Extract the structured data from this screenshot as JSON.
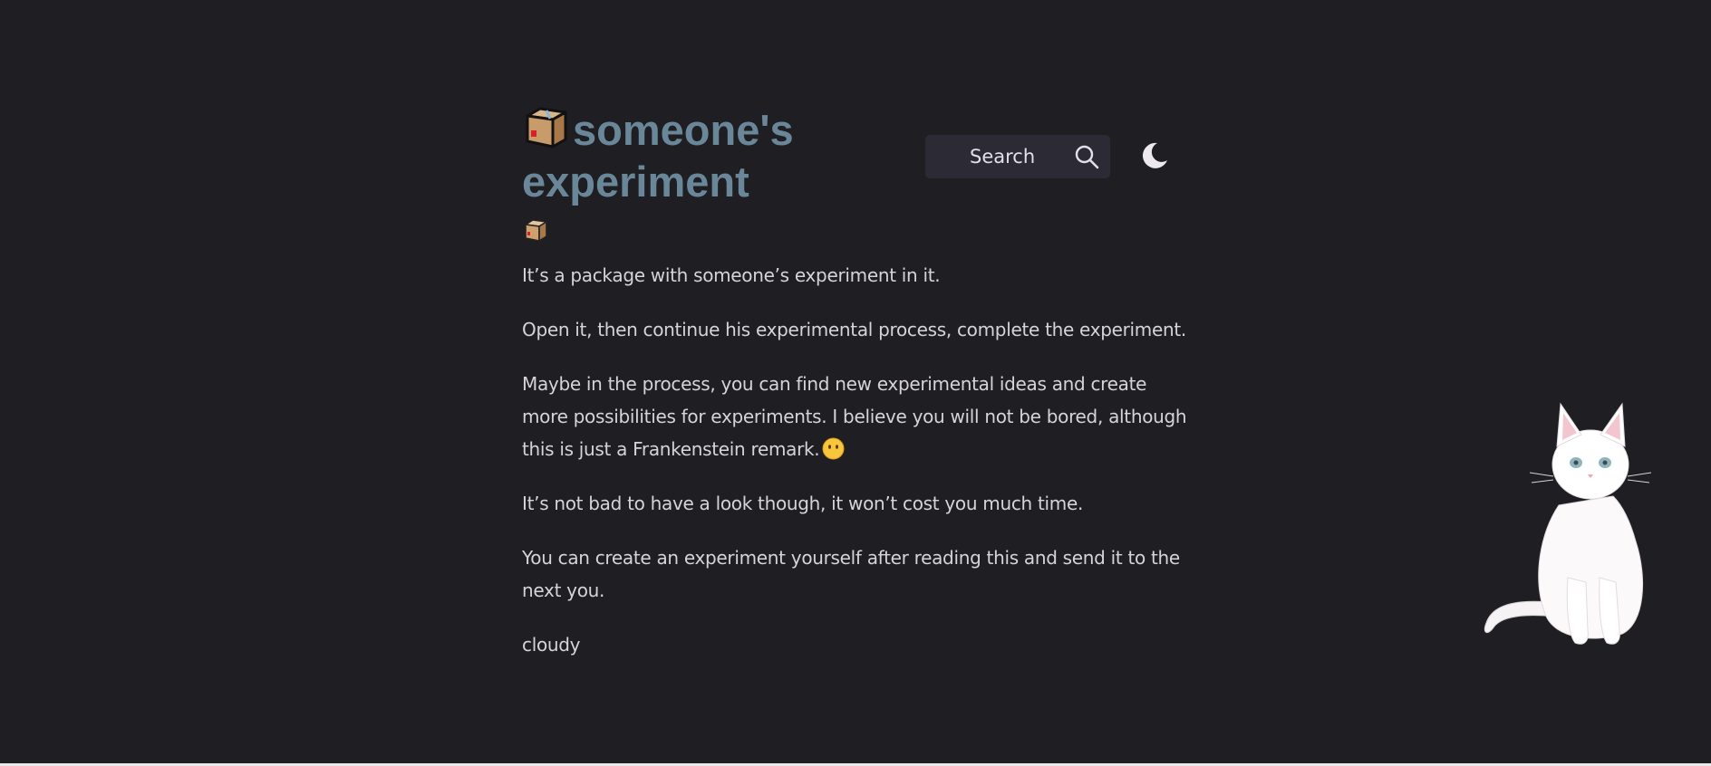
{
  "header": {
    "title_line1": "someone's",
    "title_line2": "experiment",
    "logo_icon": "package-icon",
    "search": {
      "label": "Search",
      "icon": "search-icon"
    },
    "theme_toggle_icon": "moon-icon"
  },
  "content": {
    "top_icon": "package-icon",
    "paragraphs": [
      "It’s a package with someone’s experiment in it.",
      "Open it, then continue his experimental process, complete the experiment.",
      "Maybe in the process, you can find new experimental ideas and create more possibilities for experiments. I believe you will not be bored, although this is just a Frankenstein remark.",
      "It’s not bad to have a look though, it won’t cost you much time.",
      "You can create an experiment yourself after reading this and send it to the next you.",
      "cloudy"
    ],
    "paragraph3_emoji": "no-mouth-face-icon"
  },
  "mascot": {
    "icon": "white-cat-icon"
  },
  "colors": {
    "background": "#1f1e23",
    "title": "#6a8799",
    "text": "#d6d4da",
    "search_bg": "#2c2b35"
  }
}
